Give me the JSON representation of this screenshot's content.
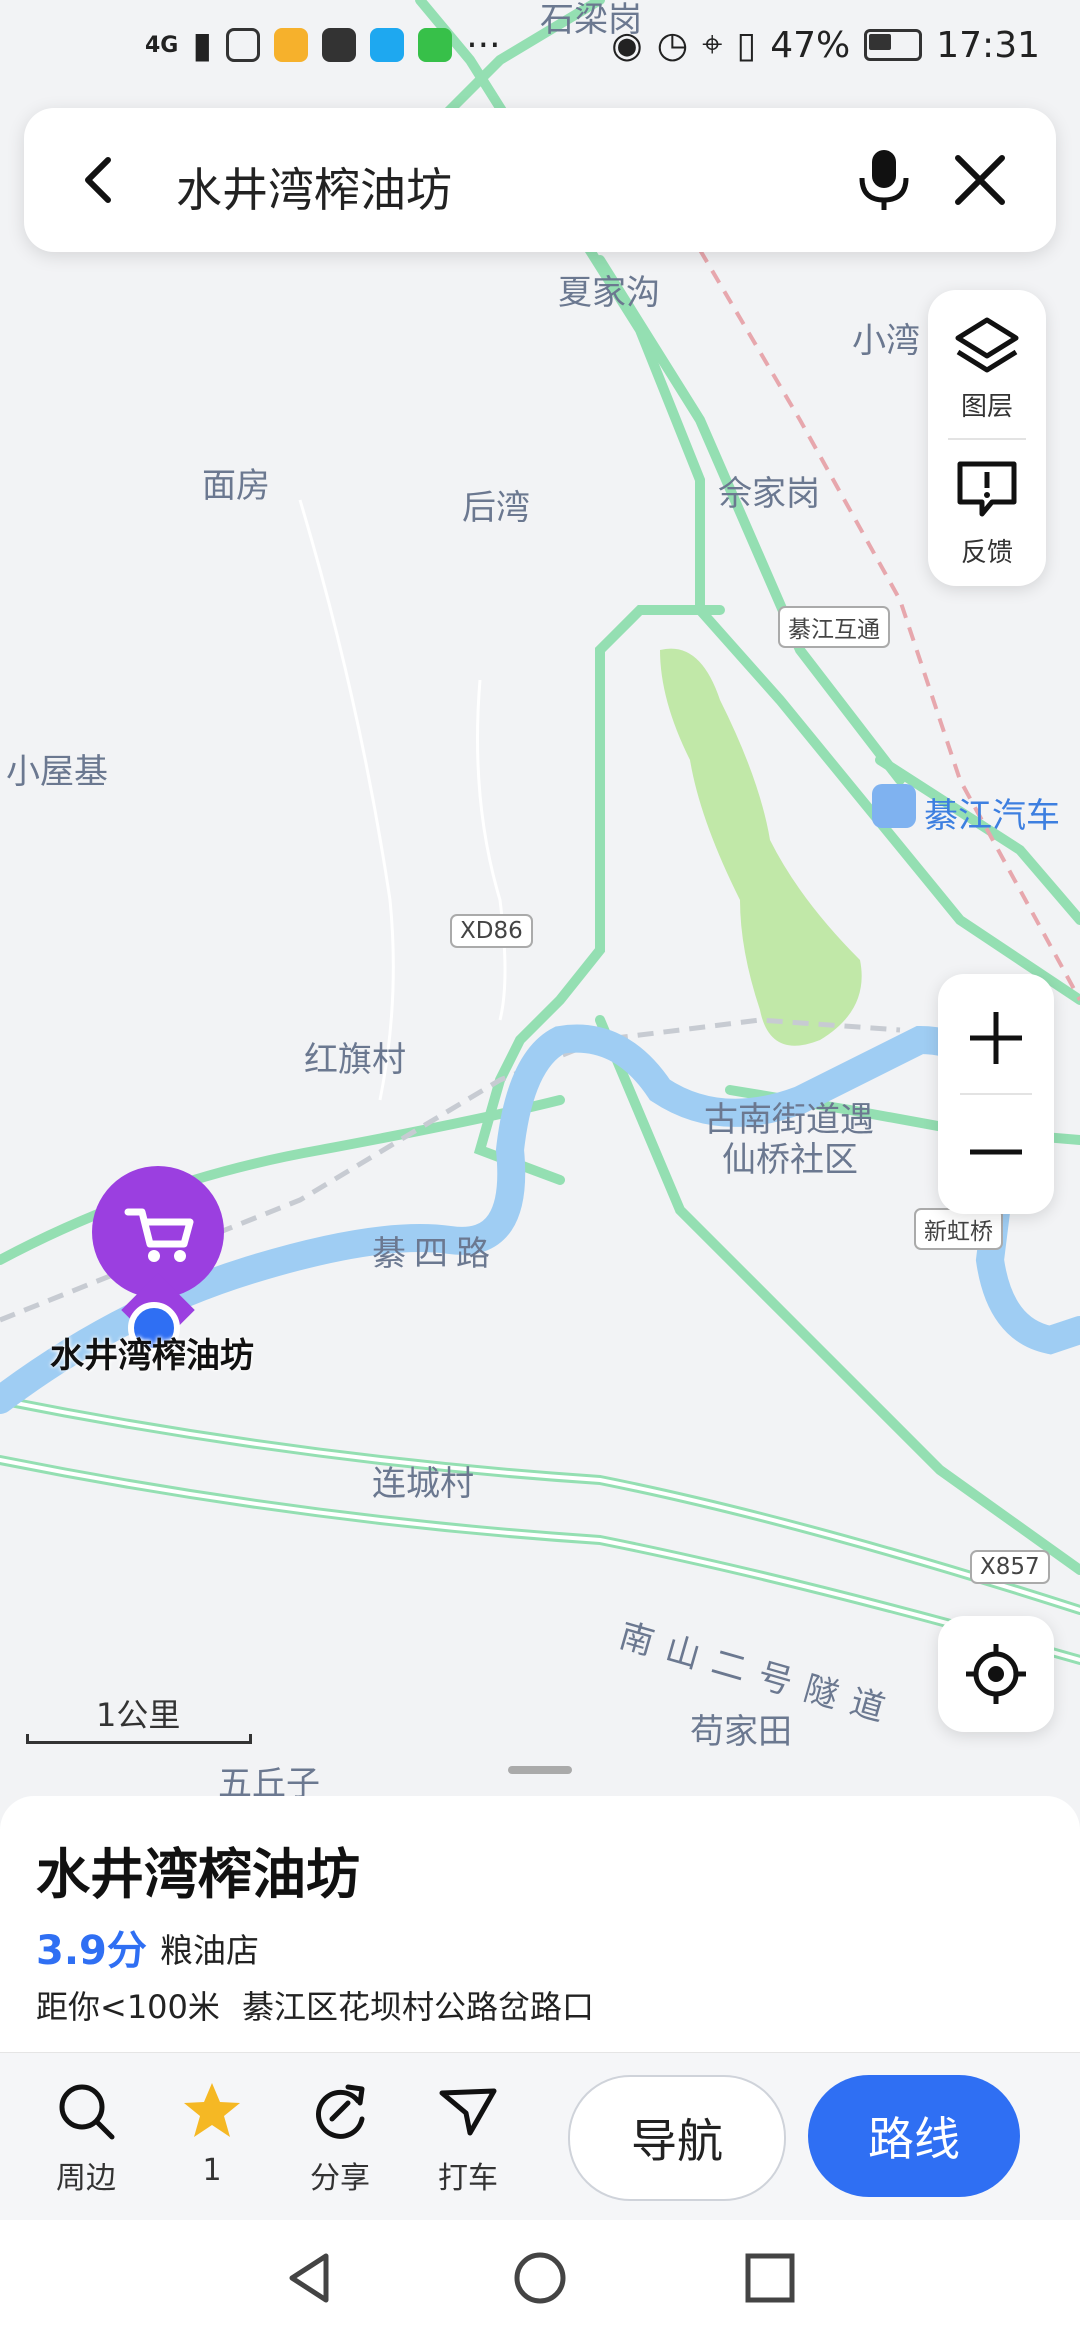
{
  "status_bar": {
    "network": "4G",
    "battery": "47%",
    "time": "17:31",
    "more": "···"
  },
  "search": {
    "query": "水井湾榨油坊"
  },
  "side_panel": {
    "layers_label": "图层",
    "feedback_label": "反馈"
  },
  "map": {
    "labels": [
      "石梁岗",
      "夏家沟",
      "小湾",
      "面房",
      "后湾",
      "佘家岗",
      "小屋基",
      "红旗村",
      "古南街道遇",
      "仙桥社区",
      "綦四路",
      "连城村",
      "南山二号隧道",
      "苟家田",
      "五丘子",
      "綦江汽车"
    ],
    "road_shields": [
      "綦江互通",
      "XD86",
      "新虹桥",
      "X857"
    ],
    "scale": "1公里",
    "marker_name": "水井湾榨油坊"
  },
  "sheet": {
    "title": "水井湾榨油坊",
    "rating": "3.9分",
    "category": "粮油店",
    "distance": "距你<100米",
    "address": "綦江区花坝村公路岔路口"
  },
  "actions": {
    "nearby": "周边",
    "favorite": "1",
    "share": "分享",
    "taxi": "打车",
    "navigate": "导航",
    "route": "路线"
  },
  "colors": {
    "accent": "#2f6ff3",
    "river": "#9fcdf3",
    "road": "#8fdcae",
    "park": "#b9e59a",
    "marker": "#9b3fe0"
  }
}
